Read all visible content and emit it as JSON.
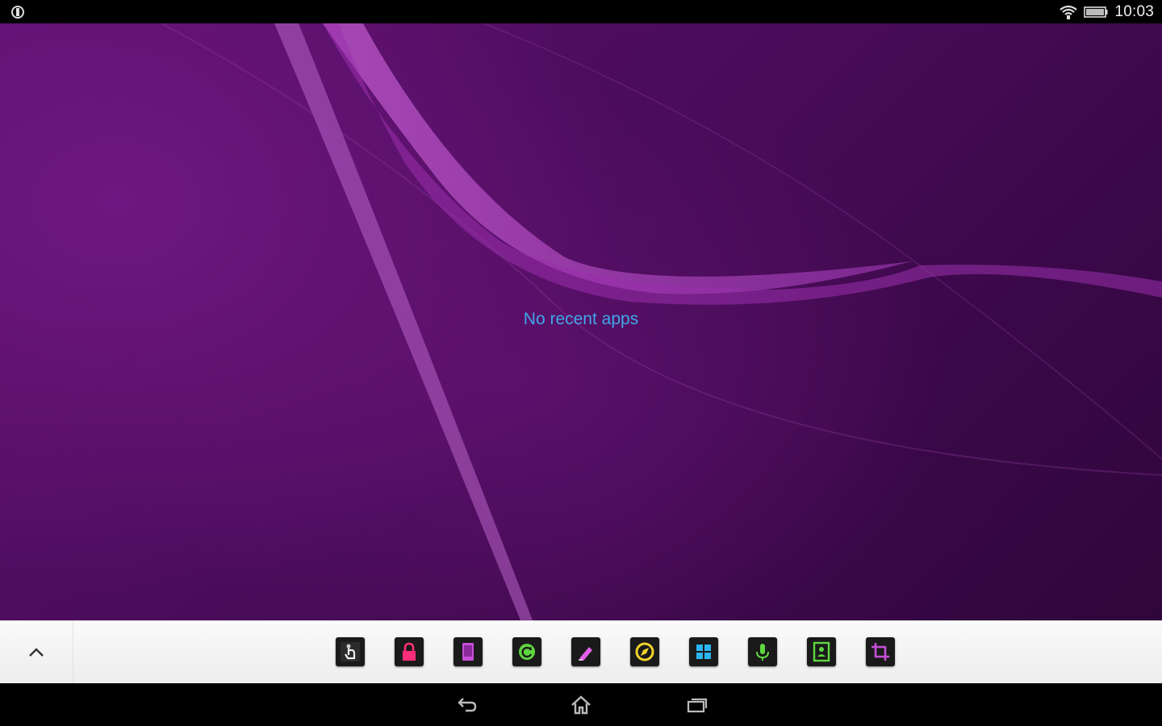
{
  "status_bar": {
    "time": "10:03",
    "left_icon": "notification-app-icon",
    "wifi_icon": "wifi-icon",
    "battery_icon": "battery-icon"
  },
  "recents": {
    "empty_message": "No recent apps"
  },
  "dock": {
    "expand_icon": "chevron-up-icon",
    "apps": [
      {
        "icon": "touch-hand-icon",
        "color": "#cccccc"
      },
      {
        "icon": "lock-icon",
        "color": "#ff2e7a"
      },
      {
        "icon": "phone-icon",
        "color": "#c64fd8"
      },
      {
        "icon": "refresh-icon",
        "color": "#5fd640"
      },
      {
        "icon": "edit-icon",
        "color": "#e060e8"
      },
      {
        "icon": "compass-icon",
        "color": "#f0d22a"
      },
      {
        "icon": "grid-icon",
        "color": "#2ab4f0"
      },
      {
        "icon": "microphone-icon",
        "color": "#5fd640"
      },
      {
        "icon": "contact-card-icon",
        "color": "#5fd640"
      },
      {
        "icon": "screenshot-crop-icon",
        "color": "#c64fd8"
      }
    ]
  },
  "nav_bar": {
    "back_icon": "back-icon",
    "home_icon": "home-icon",
    "recents_icon": "recents-icon"
  },
  "colors": {
    "wallpaper": "#4a0c5a",
    "accent_text": "#41a6e8"
  }
}
